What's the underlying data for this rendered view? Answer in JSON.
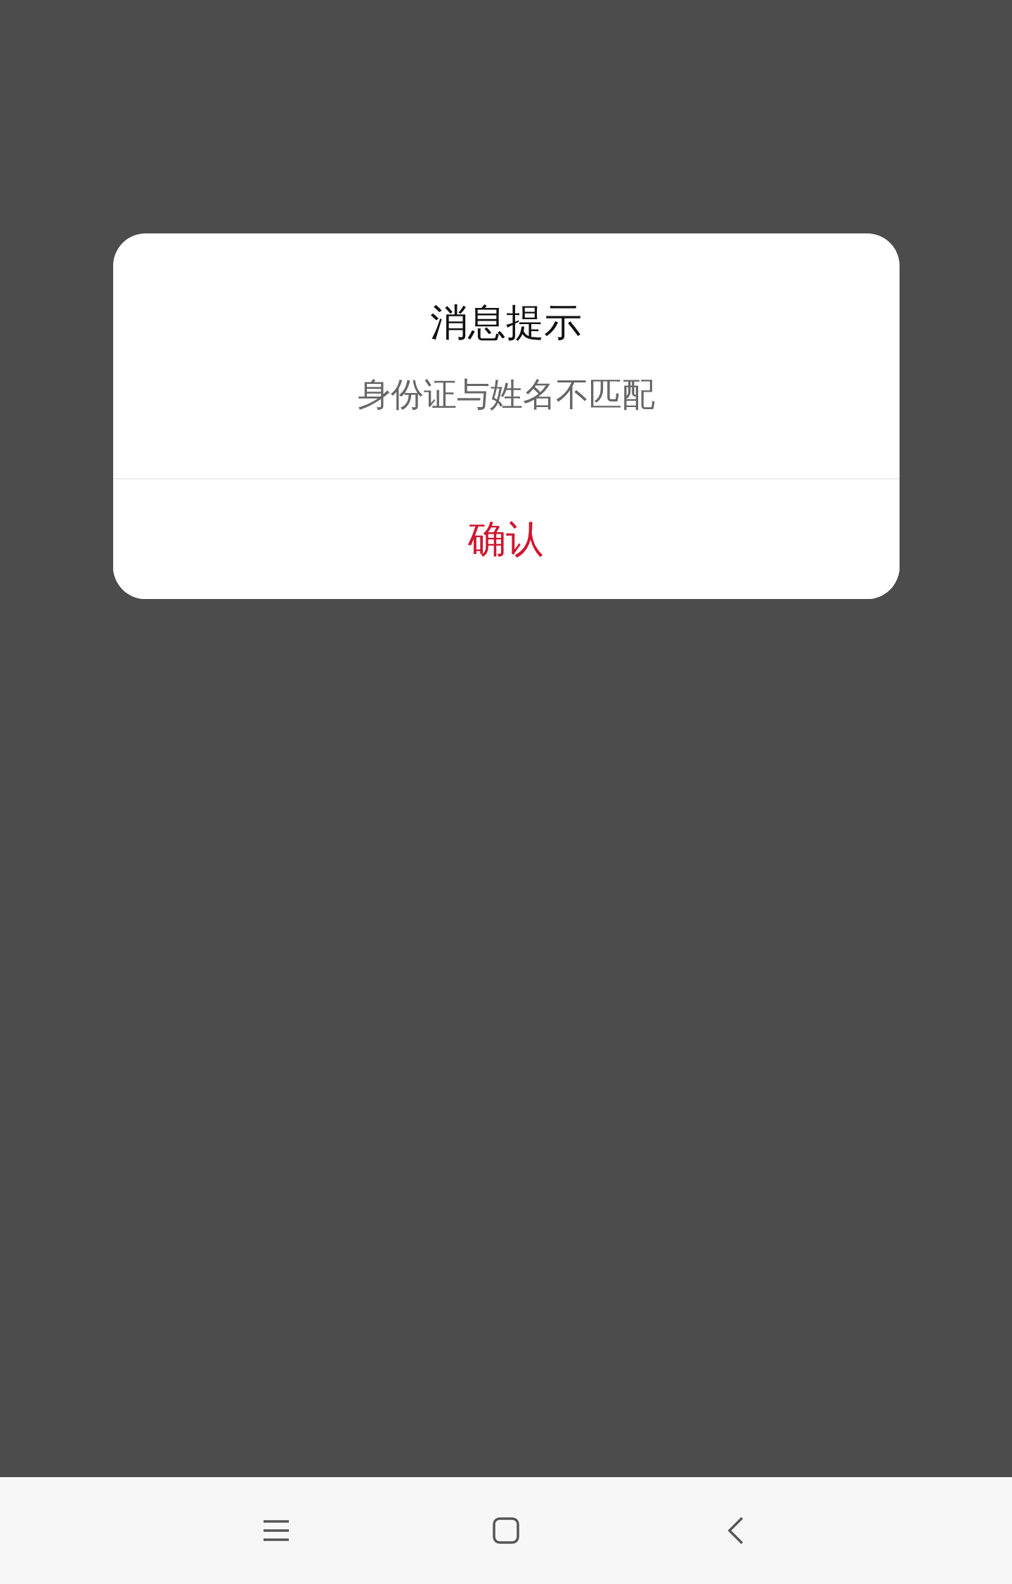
{
  "dialog": {
    "title": "消息提示",
    "message": "身份证与姓名不匹配",
    "confirm_button": "确认"
  },
  "nav_bar": {
    "buttons": [
      {
        "kind": "menu"
      },
      {
        "kind": "home"
      },
      {
        "kind": "back"
      }
    ]
  }
}
